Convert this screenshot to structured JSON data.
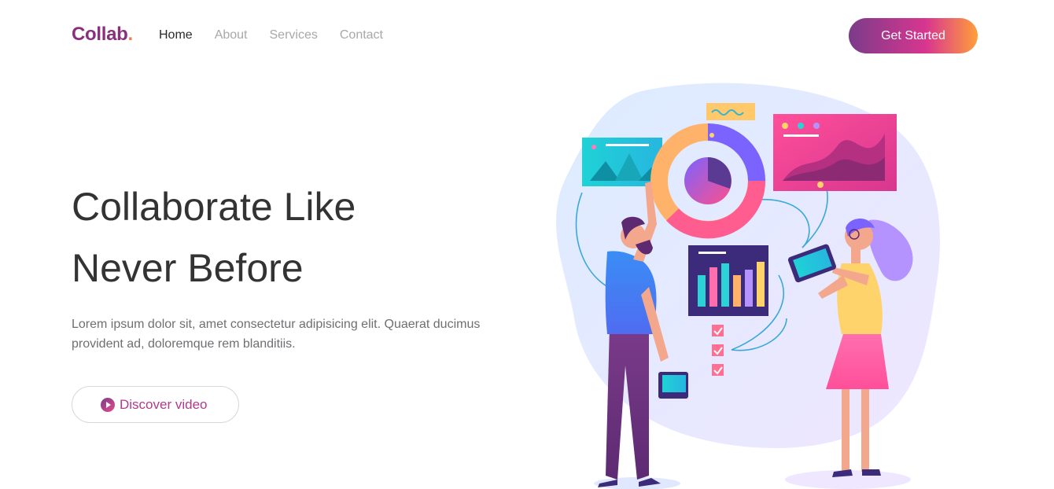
{
  "brand": {
    "name": "Collab",
    "dot": "."
  },
  "nav": {
    "links": [
      {
        "label": "Home",
        "active": true
      },
      {
        "label": "About",
        "active": false
      },
      {
        "label": "Services",
        "active": false
      },
      {
        "label": "Contact",
        "active": false
      }
    ],
    "cta_label": "Get Started"
  },
  "hero": {
    "title_line1": "Collaborate Like",
    "title_line2": "Never Before",
    "description": "Lorem ipsum dolor sit, amet consectetur adipisicing elit. Quaerat ducimus provident ad, doloremque rem blanditiis.",
    "video_label": "Discover video"
  },
  "colors": {
    "brand": "#8b2f7c",
    "accent_orange": "#f47b52",
    "gradient_start": "#7b3b8a",
    "gradient_mid": "#d8368f",
    "gradient_end": "#ff9f3a",
    "title_text": "#333333",
    "body_text": "#6f6f73"
  }
}
